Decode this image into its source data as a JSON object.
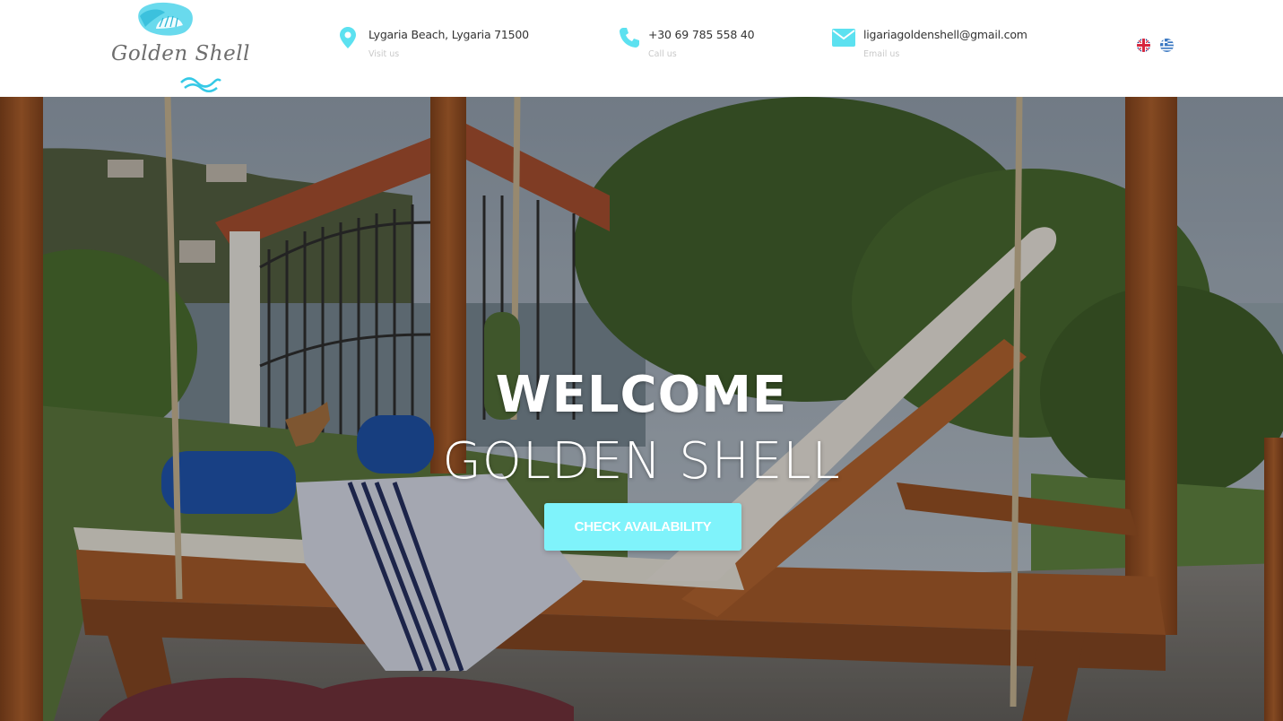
{
  "brand": {
    "name": "Golden Shell",
    "accent_color": "#5ce1f0",
    "logo_icon": "seashell-icon",
    "wave_icon": "wave-icon"
  },
  "header": {
    "address": {
      "icon": "map-pin-icon",
      "text": "Lygaria Beach, Lygaria 71500",
      "caption": "Visit us"
    },
    "phone": {
      "icon": "phone-icon",
      "text": "+30 69 785 558 40",
      "caption": "Call us"
    },
    "email": {
      "icon": "envelope-icon",
      "text": "ligariagoldenshell@gmail.com",
      "caption": "Email us"
    },
    "languages": [
      {
        "code": "en",
        "icon": "uk-flag-icon"
      },
      {
        "code": "el",
        "icon": "greek-flag-icon"
      }
    ]
  },
  "hero": {
    "title": "WELCOME",
    "subtitle": "GOLDEN SHELL",
    "cta_label": "CHECK AVAILABILITY",
    "cta_color": "#7ff3fb"
  }
}
